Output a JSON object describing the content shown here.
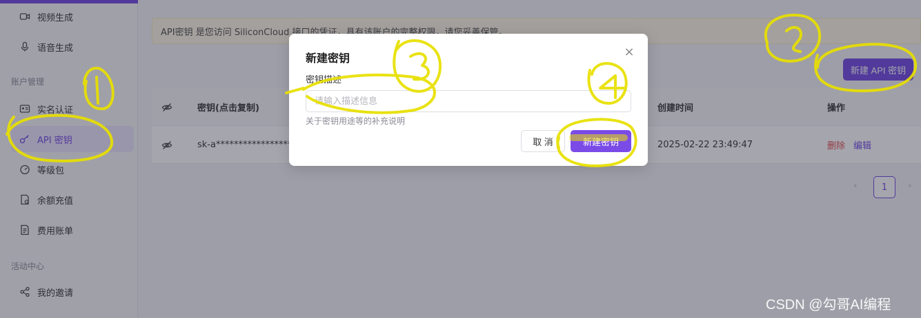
{
  "sidebar": {
    "items": [
      {
        "label": "视频生成",
        "icon": "video-icon"
      },
      {
        "label": "语音生成",
        "icon": "microphone-icon"
      },
      {
        "label": "实名认证",
        "icon": "id-card-icon"
      },
      {
        "label": "API 密钥",
        "icon": "key-icon",
        "active": true
      },
      {
        "label": "等级包",
        "icon": "gauge-icon"
      },
      {
        "label": "余额充值",
        "icon": "recharge-icon"
      },
      {
        "label": "费用账单",
        "icon": "bill-icon"
      },
      {
        "label": "我的邀请",
        "icon": "share-icon"
      }
    ],
    "sections": {
      "account": "账户管理",
      "activity": "活动中心"
    }
  },
  "notice": {
    "text": "API密钥 是您访问 SiliconCloud 接口的凭证，具有该账户的完整权限，请您妥善保管。"
  },
  "toolbar": {
    "create_label": "新建 API 密钥"
  },
  "table": {
    "headers": {
      "key": "密钥(点击复制)",
      "created": "创建时间",
      "actions": "操作"
    },
    "rows": [
      {
        "key": "sk-a******************",
        "created": "2025-02-22 23:49:47",
        "delete": "删除",
        "edit": "编辑"
      }
    ]
  },
  "pagination": {
    "current": "1",
    "prev": "‹",
    "next": "›"
  },
  "modal": {
    "title": "新建密钥",
    "field_label": "密钥描述",
    "placeholder": "请输入描述信息",
    "help": "关于密钥用途等的补充说明",
    "cancel": "取 消",
    "confirm": "新建密钥",
    "close": "×"
  },
  "annotations": {
    "one": "①",
    "two": "②",
    "three": "③",
    "four": "④"
  },
  "watermark": "CSDN @勾哥AI编程",
  "colors": {
    "accent": "#6e47e0",
    "danger": "#e04a4a",
    "highlighter": "#e8e000"
  }
}
